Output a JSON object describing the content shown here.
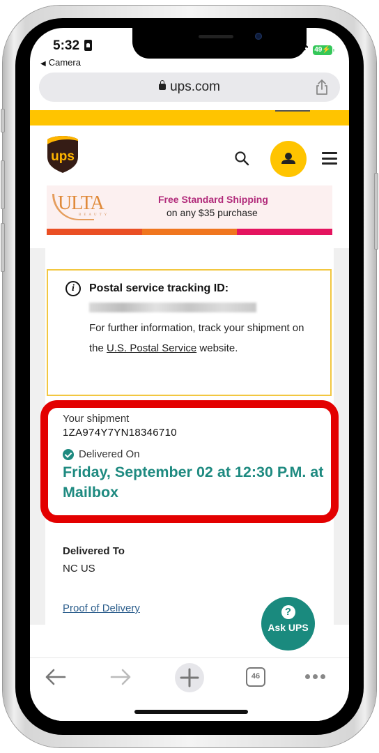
{
  "status_bar": {
    "time": "5:32",
    "back_app": "Camera",
    "battery": "49"
  },
  "browser": {
    "url": "ups.com",
    "tab_count": "46"
  },
  "site": {
    "brand": "ups",
    "ad": {
      "brand": "ULTA",
      "brand_sub": "BEAUTY",
      "line1": "Free Standard Shipping",
      "line2": "on any $35 purchase",
      "stripe_colors": [
        "#ea4f24",
        "#f0761f",
        "#e4145f"
      ]
    },
    "info_box": {
      "title": "Postal service tracking ID:",
      "text_before": "For further information, track your shipment on the ",
      "link": "U.S. Postal Service",
      "text_after": " website."
    },
    "shipment": {
      "label": "Your shipment",
      "tracking_number": "1ZA974Y7YN18346710",
      "status_label": "Delivered On",
      "delivered_date": "Friday, September 02 at 12:30 P.M. at Mailbox"
    },
    "delivered_to": {
      "label": "Delivered To",
      "value": "NC US"
    },
    "proof_link": "Proof of Delivery",
    "ask_ups": {
      "icon": "?",
      "label": "Ask UPS"
    }
  },
  "colors": {
    "ups_yellow": "#ffc400",
    "ups_brown": "#351c15",
    "teal": "#1e8a80",
    "highlight_red": "#e30000"
  }
}
